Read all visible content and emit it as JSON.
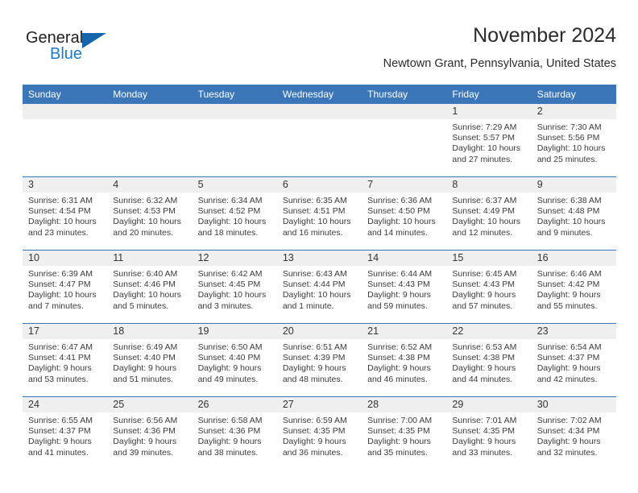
{
  "brand": {
    "name_top": "General",
    "name_bottom": "Blue",
    "triangle_color": "#1566ab",
    "blue_color": "#1f7ac4",
    "dark_color": "#231f20"
  },
  "header": {
    "month_title": "November 2024",
    "location": "Newtown Grant, Pennsylvania, United States"
  },
  "theme": {
    "header_blue": "#3a76b8",
    "daynum_band": "#efefef",
    "text": "#3a3a3a"
  },
  "weekday_headers": [
    "Sunday",
    "Monday",
    "Tuesday",
    "Wednesday",
    "Thursday",
    "Friday",
    "Saturday"
  ],
  "weeks": [
    [
      {
        "day": "",
        "empty": true
      },
      {
        "day": "",
        "empty": true
      },
      {
        "day": "",
        "empty": true
      },
      {
        "day": "",
        "empty": true
      },
      {
        "day": "",
        "empty": true
      },
      {
        "day": "1",
        "sunrise": "Sunrise: 7:29 AM",
        "sunset": "Sunset: 5:57 PM",
        "daylight": "Daylight: 10 hours and 27 minutes."
      },
      {
        "day": "2",
        "sunrise": "Sunrise: 7:30 AM",
        "sunset": "Sunset: 5:56 PM",
        "daylight": "Daylight: 10 hours and 25 minutes."
      }
    ],
    [
      {
        "day": "3",
        "sunrise": "Sunrise: 6:31 AM",
        "sunset": "Sunset: 4:54 PM",
        "daylight": "Daylight: 10 hours and 23 minutes."
      },
      {
        "day": "4",
        "sunrise": "Sunrise: 6:32 AM",
        "sunset": "Sunset: 4:53 PM",
        "daylight": "Daylight: 10 hours and 20 minutes."
      },
      {
        "day": "5",
        "sunrise": "Sunrise: 6:34 AM",
        "sunset": "Sunset: 4:52 PM",
        "daylight": "Daylight: 10 hours and 18 minutes."
      },
      {
        "day": "6",
        "sunrise": "Sunrise: 6:35 AM",
        "sunset": "Sunset: 4:51 PM",
        "daylight": "Daylight: 10 hours and 16 minutes."
      },
      {
        "day": "7",
        "sunrise": "Sunrise: 6:36 AM",
        "sunset": "Sunset: 4:50 PM",
        "daylight": "Daylight: 10 hours and 14 minutes."
      },
      {
        "day": "8",
        "sunrise": "Sunrise: 6:37 AM",
        "sunset": "Sunset: 4:49 PM",
        "daylight": "Daylight: 10 hours and 12 minutes."
      },
      {
        "day": "9",
        "sunrise": "Sunrise: 6:38 AM",
        "sunset": "Sunset: 4:48 PM",
        "daylight": "Daylight: 10 hours and 9 minutes."
      }
    ],
    [
      {
        "day": "10",
        "sunrise": "Sunrise: 6:39 AM",
        "sunset": "Sunset: 4:47 PM",
        "daylight": "Daylight: 10 hours and 7 minutes."
      },
      {
        "day": "11",
        "sunrise": "Sunrise: 6:40 AM",
        "sunset": "Sunset: 4:46 PM",
        "daylight": "Daylight: 10 hours and 5 minutes."
      },
      {
        "day": "12",
        "sunrise": "Sunrise: 6:42 AM",
        "sunset": "Sunset: 4:45 PM",
        "daylight": "Daylight: 10 hours and 3 minutes."
      },
      {
        "day": "13",
        "sunrise": "Sunrise: 6:43 AM",
        "sunset": "Sunset: 4:44 PM",
        "daylight": "Daylight: 10 hours and 1 minute."
      },
      {
        "day": "14",
        "sunrise": "Sunrise: 6:44 AM",
        "sunset": "Sunset: 4:43 PM",
        "daylight": "Daylight: 9 hours and 59 minutes."
      },
      {
        "day": "15",
        "sunrise": "Sunrise: 6:45 AM",
        "sunset": "Sunset: 4:43 PM",
        "daylight": "Daylight: 9 hours and 57 minutes."
      },
      {
        "day": "16",
        "sunrise": "Sunrise: 6:46 AM",
        "sunset": "Sunset: 4:42 PM",
        "daylight": "Daylight: 9 hours and 55 minutes."
      }
    ],
    [
      {
        "day": "17",
        "sunrise": "Sunrise: 6:47 AM",
        "sunset": "Sunset: 4:41 PM",
        "daylight": "Daylight: 9 hours and 53 minutes."
      },
      {
        "day": "18",
        "sunrise": "Sunrise: 6:49 AM",
        "sunset": "Sunset: 4:40 PM",
        "daylight": "Daylight: 9 hours and 51 minutes."
      },
      {
        "day": "19",
        "sunrise": "Sunrise: 6:50 AM",
        "sunset": "Sunset: 4:40 PM",
        "daylight": "Daylight: 9 hours and 49 minutes."
      },
      {
        "day": "20",
        "sunrise": "Sunrise: 6:51 AM",
        "sunset": "Sunset: 4:39 PM",
        "daylight": "Daylight: 9 hours and 48 minutes."
      },
      {
        "day": "21",
        "sunrise": "Sunrise: 6:52 AM",
        "sunset": "Sunset: 4:38 PM",
        "daylight": "Daylight: 9 hours and 46 minutes."
      },
      {
        "day": "22",
        "sunrise": "Sunrise: 6:53 AM",
        "sunset": "Sunset: 4:38 PM",
        "daylight": "Daylight: 9 hours and 44 minutes."
      },
      {
        "day": "23",
        "sunrise": "Sunrise: 6:54 AM",
        "sunset": "Sunset: 4:37 PM",
        "daylight": "Daylight: 9 hours and 42 minutes."
      }
    ],
    [
      {
        "day": "24",
        "sunrise": "Sunrise: 6:55 AM",
        "sunset": "Sunset: 4:37 PM",
        "daylight": "Daylight: 9 hours and 41 minutes."
      },
      {
        "day": "25",
        "sunrise": "Sunrise: 6:56 AM",
        "sunset": "Sunset: 4:36 PM",
        "daylight": "Daylight: 9 hours and 39 minutes."
      },
      {
        "day": "26",
        "sunrise": "Sunrise: 6:58 AM",
        "sunset": "Sunset: 4:36 PM",
        "daylight": "Daylight: 9 hours and 38 minutes."
      },
      {
        "day": "27",
        "sunrise": "Sunrise: 6:59 AM",
        "sunset": "Sunset: 4:35 PM",
        "daylight": "Daylight: 9 hours and 36 minutes."
      },
      {
        "day": "28",
        "sunrise": "Sunrise: 7:00 AM",
        "sunset": "Sunset: 4:35 PM",
        "daylight": "Daylight: 9 hours and 35 minutes."
      },
      {
        "day": "29",
        "sunrise": "Sunrise: 7:01 AM",
        "sunset": "Sunset: 4:35 PM",
        "daylight": "Daylight: 9 hours and 33 minutes."
      },
      {
        "day": "30",
        "sunrise": "Sunrise: 7:02 AM",
        "sunset": "Sunset: 4:34 PM",
        "daylight": "Daylight: 9 hours and 32 minutes."
      }
    ]
  ]
}
